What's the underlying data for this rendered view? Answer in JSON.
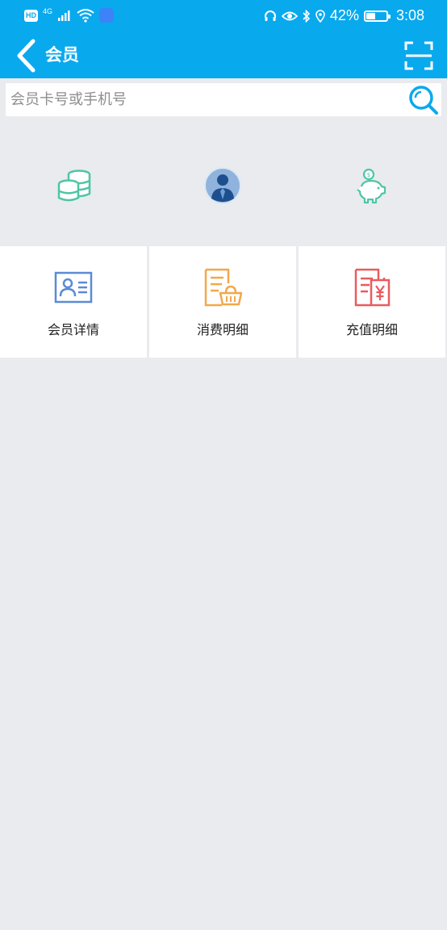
{
  "status_bar": {
    "hd_label": "HD",
    "signal_label": "4G",
    "battery_percent": "42%",
    "battery_level": 0.42,
    "time": "3:08"
  },
  "nav": {
    "title": "会员"
  },
  "search": {
    "placeholder": "会员卡号或手机号",
    "value": ""
  },
  "stats": [
    {
      "icon": "coins-stack-icon"
    },
    {
      "icon": "member-avatar-icon"
    },
    {
      "icon": "piggy-bank-icon"
    }
  ],
  "tiles": [
    {
      "label": "会员详情",
      "icon": "member-card-icon"
    },
    {
      "label": "消费明细",
      "icon": "consumption-detail-icon"
    },
    {
      "label": "充值明细",
      "icon": "recharge-detail-icon"
    }
  ],
  "colors": {
    "header": "#09a9ee",
    "background": "#e9ebee",
    "teal_icon": "#4fc5a6",
    "blue_icon": "#5a8bd6",
    "orange_icon": "#f2a84a",
    "red_icon": "#e95b5f"
  }
}
